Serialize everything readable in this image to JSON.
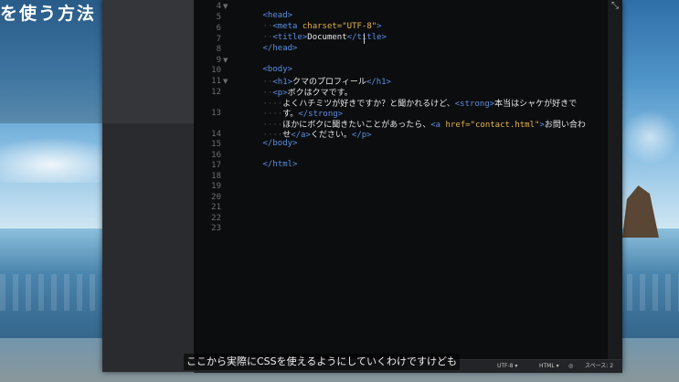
{
  "overlay_title": "を使う方法",
  "subtitle": "ここから実際にCSSを使えるようにしていくわけですけども",
  "editor": {
    "lines": [
      {
        "n": "4",
        "fold": true
      },
      {
        "n": "5",
        "fold": false
      },
      {
        "n": "6",
        "fold": false
      },
      {
        "n": "7",
        "fold": false
      },
      {
        "n": "8",
        "fold": false
      },
      {
        "n": "9",
        "fold": true
      },
      {
        "n": "10",
        "fold": false
      },
      {
        "n": "11",
        "fold": true
      },
      {
        "n": "12",
        "fold": false
      },
      {
        "n": "13",
        "fold": false
      },
      {
        "n": "14",
        "fold": false
      },
      {
        "n": "15",
        "fold": false
      },
      {
        "n": "16",
        "fold": false
      },
      {
        "n": "17",
        "fold": false
      },
      {
        "n": "18",
        "fold": false
      },
      {
        "n": "19",
        "fold": false
      },
      {
        "n": "20",
        "fold": false
      },
      {
        "n": "21",
        "fold": false
      },
      {
        "n": "22",
        "fold": false
      },
      {
        "n": "23",
        "fold": false
      }
    ],
    "code": {
      "l4": {
        "tag": "<head>"
      },
      "l5": {
        "indent": "··",
        "tag_open": "<meta",
        "attr": "charset=",
        "str": "\"UTF-8\"",
        "tag_close": ">"
      },
      "l6": {
        "indent": "··",
        "tag_open": "<title>",
        "text": "Document",
        "tag_close": "</title>"
      },
      "l7": {
        "tag": "</head>"
      },
      "l9": {
        "tag": "<body>"
      },
      "l10": {
        "indent": "··",
        "tag_open": "<h1>",
        "text": "クマのプロフィール",
        "tag_close": "</h1>"
      },
      "l11": {
        "indent": "··",
        "tag_open": "<p>",
        "text": "ボクはクマです。"
      },
      "l12a": {
        "indent": "····",
        "text": "よくハチミツが好きですか？と聞かれるけど、",
        "tag_open": "<strong>",
        "text2": "本当はシャケが好きで"
      },
      "l12b": {
        "indent": "····",
        "text": "す。",
        "tag_close": "</strong>"
      },
      "l13a": {
        "indent": "····",
        "text": "ほかにボクに聞きたいことがあったら、",
        "tag_open": "<a",
        "attr": " href=",
        "str": "\"contact.html\"",
        "tag_close": ">",
        "text2": "お問い合わ"
      },
      "l13b": {
        "indent": "····",
        "text": "せ",
        "tag_open": "</a>",
        "text2": "ください。",
        "tag_close": "</p>"
      },
      "l14": {
        "tag": "</body>"
      },
      "l16": {
        "tag": "</html>"
      }
    }
  },
  "statusbar": {
    "encoding": "UTF-8 ▾",
    "language": "HTML ▾",
    "lint": "◎",
    "indent": "スペース: 2"
  },
  "icons": {
    "scroll_corner": "resize-corner-icon"
  }
}
